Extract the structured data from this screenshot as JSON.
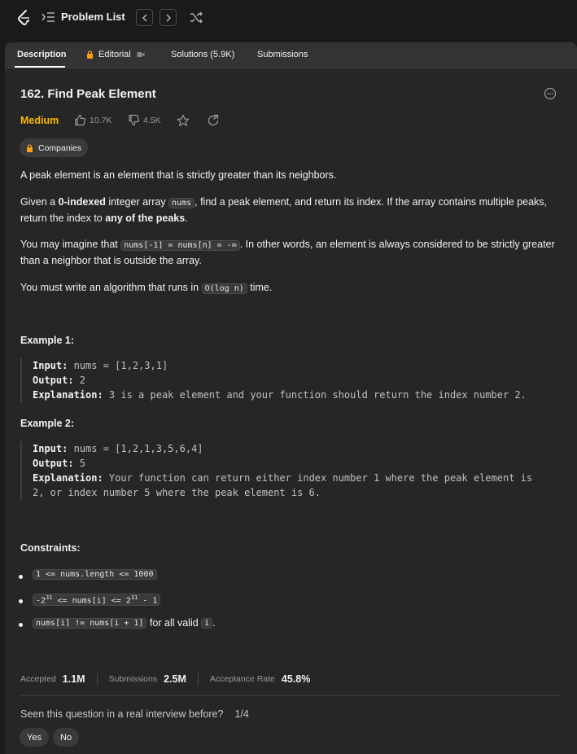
{
  "topbar": {
    "title": "Problem List",
    "icons": [
      "logo-icon",
      "problem-list-icon",
      "chevron-left-icon",
      "chevron-right-icon",
      "shuffle-icon"
    ]
  },
  "tabs": [
    {
      "label": "Description"
    },
    {
      "label": "Editorial"
    },
    {
      "label": "Solutions (5.9K)"
    },
    {
      "label": "Submissions"
    }
  ],
  "problem": {
    "title": "162. Find Peak Element",
    "difficulty": "Medium",
    "likes": "10.7K",
    "dislikes": "4.5K",
    "companies_label": "Companies"
  },
  "description": {
    "p1": "A peak element is an element that is strictly greater than its neighbors.",
    "p2_a": "Given a ",
    "p2_b": "0-indexed",
    "p2_c": " integer array ",
    "p2_code": "nums",
    "p2_d": ", find a peak element, and return its index. If the array contains multiple peaks, return the index to ",
    "p2_e": "any of the peaks",
    "p2_f": ".",
    "p3_a": "You may imagine that ",
    "p3_code": "nums[-1] = nums[n] = -∞",
    "p3_b": ". In other words, an element is always considered to be strictly greater than a neighbor that is outside the array.",
    "p4_a": "You must write an algorithm that runs in ",
    "p4_code": "O(log n)",
    "p4_b": " time."
  },
  "examples": [
    {
      "heading": "Example 1:",
      "input_label": "Input:",
      "input": " nums = [1,2,3,1]",
      "output_label": "Output:",
      "output": " 2",
      "explanation_label": "Explanation:",
      "explanation": " 3 is a peak element and your function should return the index number 2."
    },
    {
      "heading": "Example 2:",
      "input_label": "Input:",
      "input": " nums = [1,2,1,3,5,6,4]",
      "output_label": "Output:",
      "output": " 5",
      "explanation_label": "Explanation:",
      "explanation": " Your function can return either index number 1 where the peak element is",
      "explanation_2": "2, or index number 5 where the peak element is 6."
    }
  ],
  "constraints": {
    "heading": "Constraints:",
    "c1": "1 <= nums.length <= 1000",
    "c2_a": "-2",
    "c2_sup1": "31",
    "c2_b": " <= nums[i] <= 2",
    "c2_sup2": "31",
    "c2_c": " - 1",
    "c3_code": "nums[i] != nums[i + 1]",
    "c3_text": " for all valid ",
    "c3_code2": "i",
    "c3_end": "."
  },
  "stats": {
    "accepted_label": "Accepted",
    "accepted": "1.1M",
    "submissions_label": "Submissions",
    "submissions": "2.5M",
    "rate_label": "Acceptance Rate",
    "rate": "45.8%"
  },
  "interview": {
    "question": "Seen this question in a real interview before?",
    "count": "1/4",
    "yes": "Yes",
    "no": "No"
  },
  "colors": {
    "background": "#1a1a1a",
    "panel": "#262626",
    "medium": "#ffb700",
    "text": "#eff1f6"
  }
}
